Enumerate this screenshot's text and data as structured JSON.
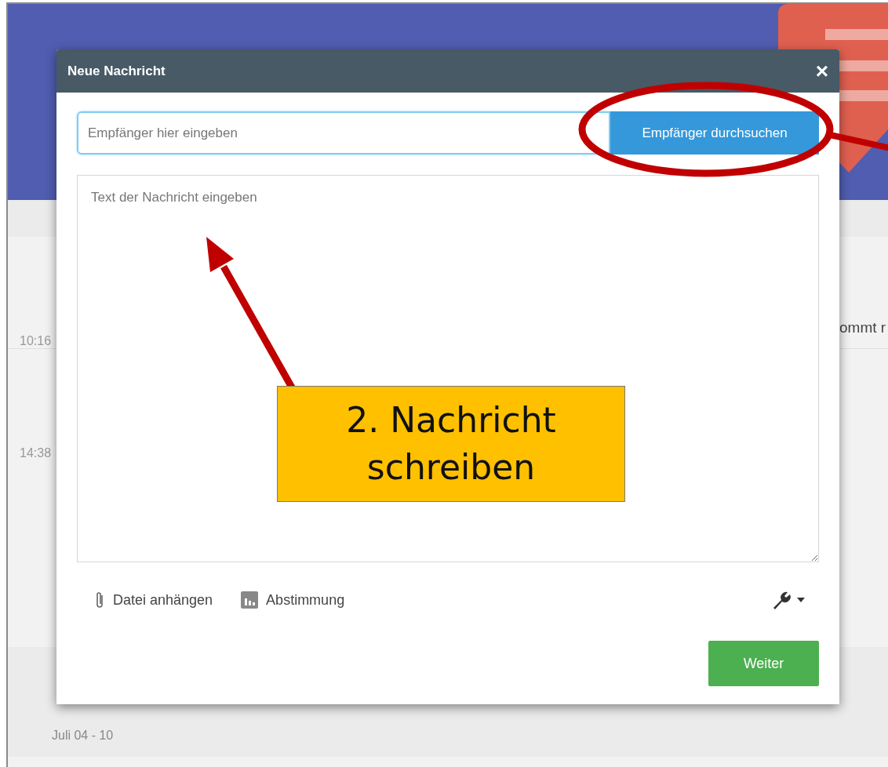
{
  "background": {
    "messages": [
      {
        "time": "10:16",
        "preview_fragment": "ommt r"
      },
      {
        "time": "14:38"
      }
    ],
    "week_last": "Juli 04 - 10"
  },
  "dialog": {
    "title": "Neue Nachricht",
    "close": "×",
    "recipient": {
      "placeholder": "Empfänger hier eingeben",
      "focused": true
    },
    "search_button": "Empfänger durchsuchen",
    "message": {
      "placeholder": "Text der Nachricht eingeben"
    },
    "tools": [
      {
        "kind": "attach",
        "label": "Datei anhängen"
      },
      {
        "kind": "poll",
        "label": "Abstimmung"
      }
    ],
    "submit": "Weiter"
  },
  "annotation": {
    "callout": "2. Nachricht schreiben"
  }
}
